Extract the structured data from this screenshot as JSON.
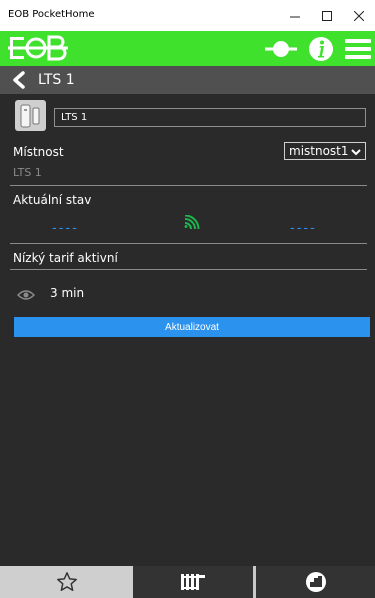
{
  "window": {
    "title": "EOB PocketHome"
  },
  "header": {
    "logo": "EOB",
    "icons": [
      "connect-icon",
      "info-icon",
      "menu-icon"
    ]
  },
  "page": {
    "title": "LTS 1"
  },
  "device": {
    "name_value": "LTS 1",
    "room_label": "Místnost",
    "room_value": "mistnost1",
    "subtitle": "LTS 1"
  },
  "status": {
    "label": "Aktuální stav",
    "left_value": "----",
    "right_value": "----"
  },
  "tariff": {
    "label": "Nízký tarif aktivní"
  },
  "refresh": {
    "interval": "3 min"
  },
  "actions": {
    "update_label": "Aktualizovat"
  },
  "bottom_nav": {
    "items": [
      "favorites-icon",
      "radiator-icon",
      "statistics-icon"
    ]
  },
  "colors": {
    "brand_green": "#3fe12c",
    "accent_blue": "#2b92ee",
    "background": "#2a2a2a"
  }
}
